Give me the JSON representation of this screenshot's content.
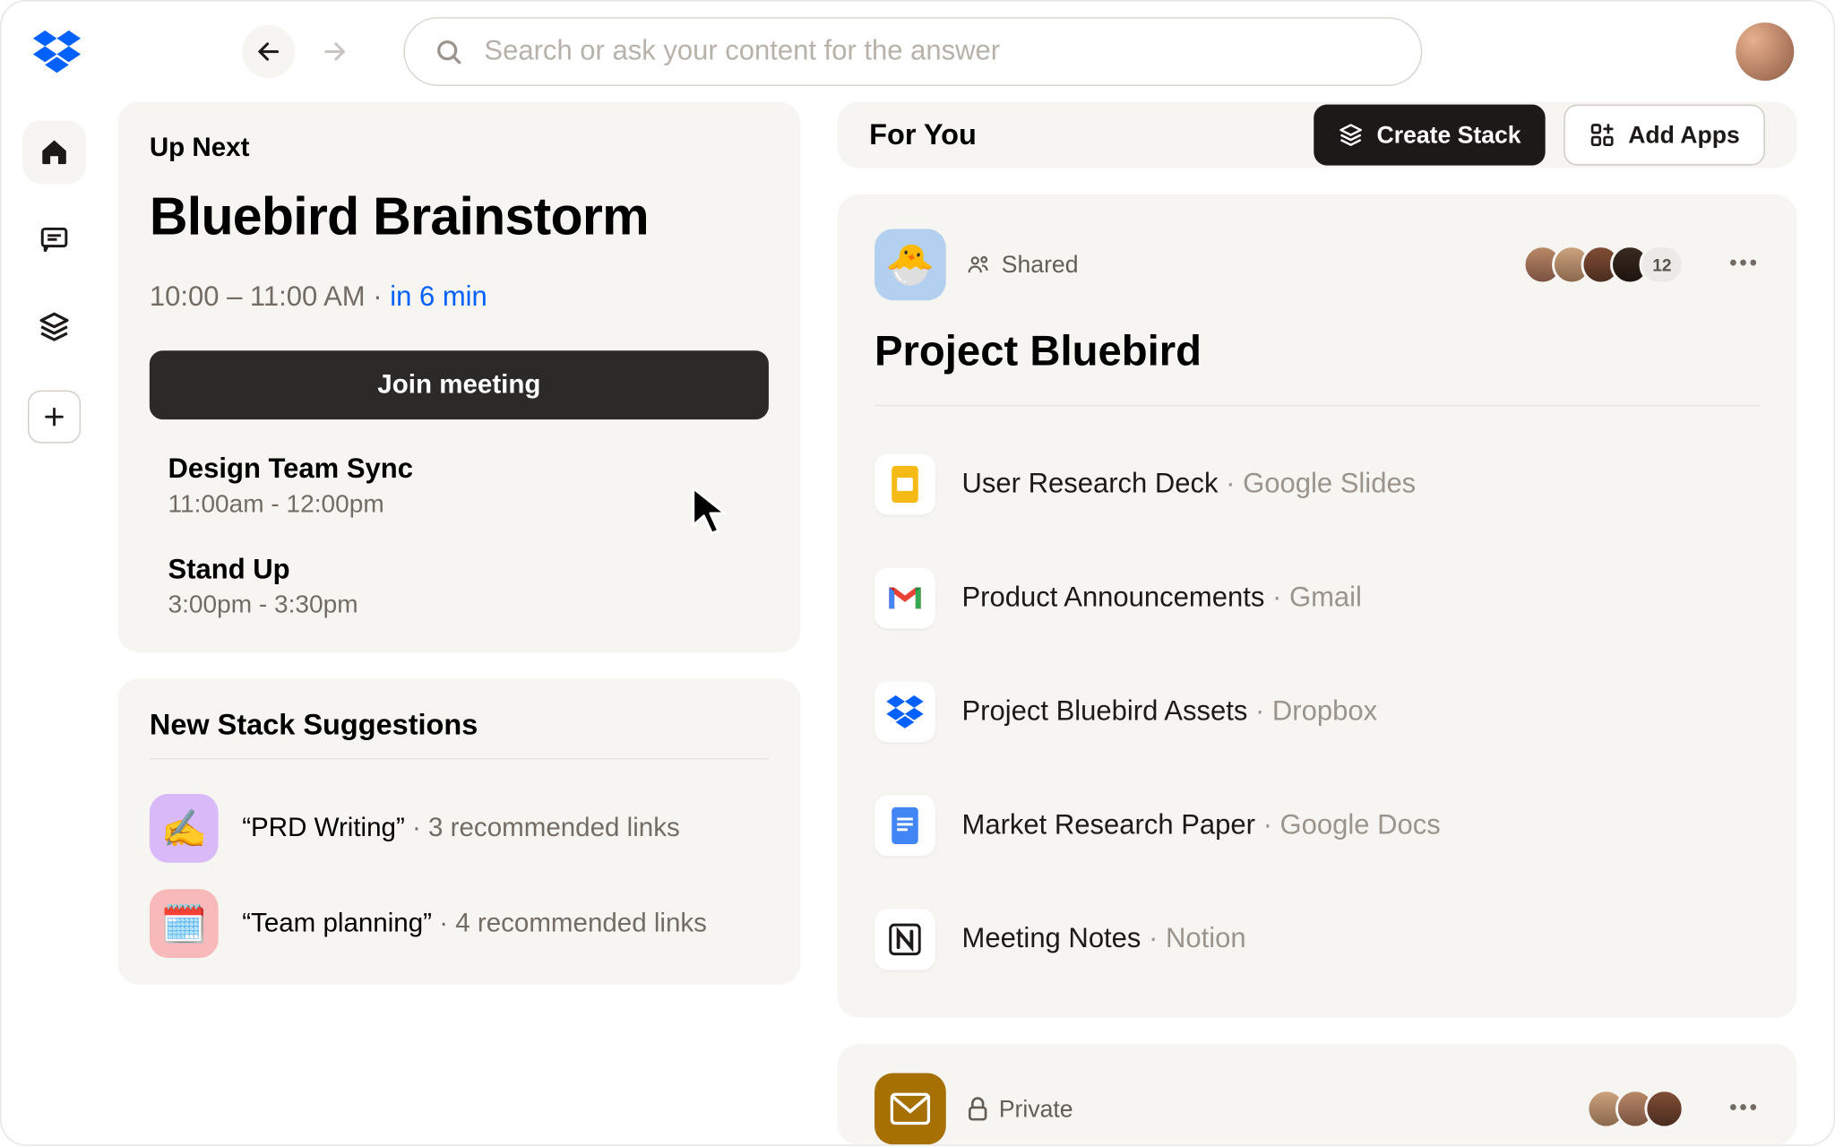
{
  "search": {
    "placeholder": "Search or ask your content for the answer"
  },
  "upnext": {
    "label": "Up Next",
    "title": "Bluebird Brainstorm",
    "time_range": "10:00 – 11:00 AM",
    "sep": " · ",
    "relative": "in 6 min",
    "join_label": "Join meeting",
    "events": [
      {
        "title": "Design Team Sync",
        "time": "11:00am - 12:00pm"
      },
      {
        "title": "Stand Up",
        "time": "3:00pm - 3:30pm"
      }
    ]
  },
  "stack_suggestions": {
    "heading": "New Stack Suggestions",
    "items": [
      {
        "emoji": "✍️",
        "bg": "#d9b9f7",
        "label": "“PRD Writing”",
        "sub": "3 recommended links"
      },
      {
        "emoji": "🗓️",
        "bg": "#f7b9b9",
        "label": "“Team planning”",
        "sub": "4 recommended links"
      }
    ]
  },
  "foryou": {
    "title": "For You",
    "create_stack": "Create Stack",
    "add_apps": "Add Apps"
  },
  "project": {
    "emoji": "🐣",
    "shared_label": "Shared",
    "title": "Project Bluebird",
    "extra_count": "12",
    "files": [
      {
        "name": "User Research Deck",
        "src": "Google Slides",
        "icon": "slides"
      },
      {
        "name": "Product Announcements",
        "src": "Gmail",
        "icon": "gmail"
      },
      {
        "name": "Project Bluebird Assets",
        "src": "Dropbox",
        "icon": "dropbox"
      },
      {
        "name": "Market Research Paper",
        "src": "Google Docs",
        "icon": "docs"
      },
      {
        "name": "Meeting Notes",
        "src": "Notion",
        "icon": "notion"
      }
    ]
  },
  "private": {
    "label": "Private"
  },
  "sep_dot": "  ·  "
}
